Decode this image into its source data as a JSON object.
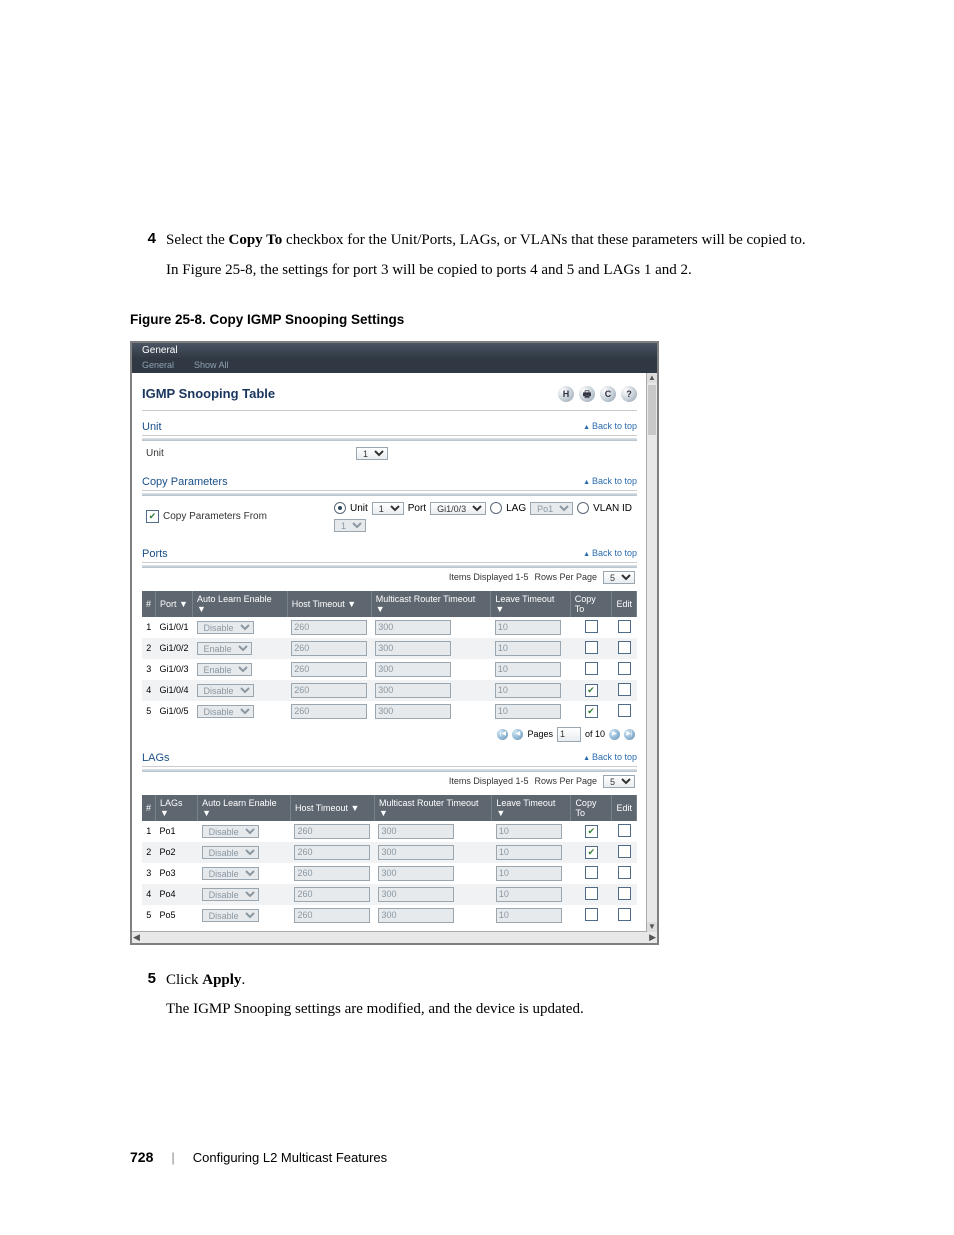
{
  "step4": {
    "num": "4",
    "p1a": "Select the ",
    "p1b": "Copy To",
    "p1c": " checkbox for the Unit/Ports, LAGs, or VLANs that these parameters will be copied to.",
    "p2": "In Figure 25-8, the settings for port 3 will be copied to ports 4 and 5 and LAGs 1 and 2."
  },
  "figcap": "Figure 25-8.    Copy IGMP Snooping Settings",
  "step5": {
    "num": "5",
    "p1a": "Click ",
    "p1b": "Apply",
    "p1c": ".",
    "p2": "The IGMP Snooping settings are modified, and the device is updated."
  },
  "footer": {
    "page": "728",
    "section": "Configuring L2 Multicast Features"
  },
  "shot": {
    "tab_top": "General",
    "tab_left": "General",
    "tab_right": "Show All",
    "title": "IGMP Snooping Table",
    "icons": {
      "save": "H",
      "print": "🖶",
      "refresh": "C",
      "help": "?"
    },
    "backtop": "Back to top",
    "unit_label": "Unit",
    "unit_section": "Unit",
    "unit_value": "1",
    "copy_params_section": "Copy Parameters",
    "cpf_label": "Copy Parameters From",
    "copy_from": {
      "unit_lbl": "Unit",
      "unit_val": "1",
      "port_lbl": "Port",
      "port_val": "Gi1/0/3",
      "lag_lbl": "LAG",
      "lag_val": "Po1",
      "vlan_lbl": "VLAN ID",
      "vlan_val": "1"
    },
    "ports_section": "Ports",
    "lags_section": "LAGs",
    "items_displayed": "Items Displayed 1-5",
    "rows_per_page_lbl": "Rows Per Page",
    "rows_per_page_val": "5",
    "cols": {
      "idx": "#",
      "port": "Port",
      "lags": "LAGs",
      "auto": "Auto Learn Enable",
      "host": "Host Timeout",
      "router": "Multicast Router Timeout",
      "leave": "Leave Timeout",
      "copy": "Copy To",
      "edit": "Edit"
    },
    "ports": [
      {
        "idx": "1",
        "port": "Gi1/0/1",
        "auto": "Disable",
        "host": "260",
        "router": "300",
        "leave": "10",
        "copy": false
      },
      {
        "idx": "2",
        "port": "Gi1/0/2",
        "auto": "Enable",
        "host": "260",
        "router": "300",
        "leave": "10",
        "copy": false
      },
      {
        "idx": "3",
        "port": "Gi1/0/3",
        "auto": "Enable",
        "host": "260",
        "router": "300",
        "leave": "10",
        "copy": false
      },
      {
        "idx": "4",
        "port": "Gi1/0/4",
        "auto": "Disable",
        "host": "260",
        "router": "300",
        "leave": "10",
        "copy": true
      },
      {
        "idx": "5",
        "port": "Gi1/0/5",
        "auto": "Disable",
        "host": "260",
        "router": "300",
        "leave": "10",
        "copy": true
      }
    ],
    "lags": [
      {
        "idx": "1",
        "port": "Po1",
        "auto": "Disable",
        "host": "260",
        "router": "300",
        "leave": "10",
        "copy": true
      },
      {
        "idx": "2",
        "port": "Po2",
        "auto": "Disable",
        "host": "260",
        "router": "300",
        "leave": "10",
        "copy": true
      },
      {
        "idx": "3",
        "port": "Po3",
        "auto": "Disable",
        "host": "260",
        "router": "300",
        "leave": "10",
        "copy": false
      },
      {
        "idx": "4",
        "port": "Po4",
        "auto": "Disable",
        "host": "260",
        "router": "300",
        "leave": "10",
        "copy": false
      },
      {
        "idx": "5",
        "port": "Po5",
        "auto": "Disable",
        "host": "260",
        "router": "300",
        "leave": "10",
        "copy": false
      }
    ],
    "pager": {
      "pages_lbl": "Pages",
      "page_val": "1",
      "of": "of 10"
    }
  }
}
